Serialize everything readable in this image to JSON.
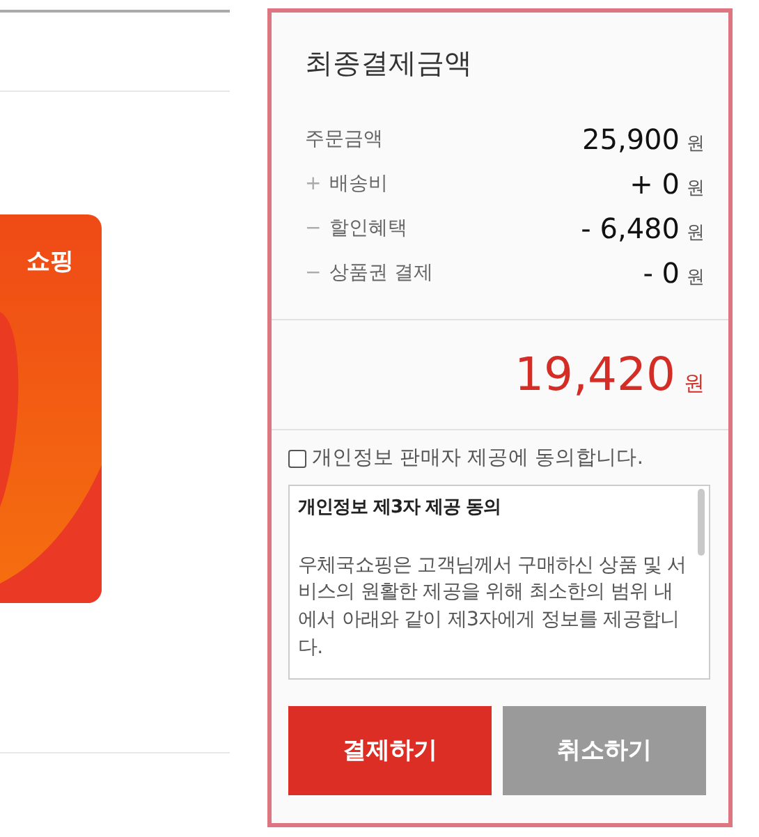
{
  "promo_card": {
    "brand_fragment": "쇼핑"
  },
  "summary": {
    "title": "최종결제금액",
    "rows": [
      {
        "kind": "base",
        "label": "주문금액",
        "value": "25,900",
        "unit": "원"
      },
      {
        "kind": "plus",
        "sign": "+",
        "label": "배송비",
        "value": "+ 0",
        "unit": "원"
      },
      {
        "kind": "minus",
        "sign": "−",
        "label": "할인혜택",
        "value": "- 6,480",
        "unit": "원"
      },
      {
        "kind": "minus",
        "sign": "−",
        "label": "상품권 결제",
        "value": "- 0",
        "unit": "원"
      }
    ],
    "total": {
      "value": "19,420",
      "unit": "원"
    },
    "consent": {
      "label": "개인정보 판매자 제공에 동의합니다.",
      "checked": false
    },
    "terms": {
      "title": "개인정보 제3자 제공 동의",
      "body": "우체국쇼핑은 고객님께서 구매하신 상품 및 서비스의 원활한 제공을 위해 최소한의 범위 내에서 아래와 같이 제3자에게 정보를 제공합니다."
    },
    "buttons": [
      {
        "kind": "primary",
        "label": "결제하기"
      },
      {
        "kind": "secondary",
        "label": "취소하기"
      }
    ]
  }
}
